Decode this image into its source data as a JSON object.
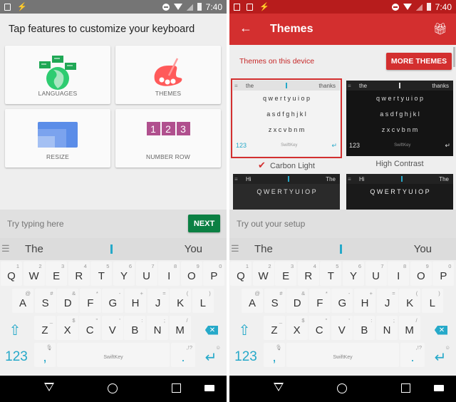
{
  "status_bar": {
    "time": "7:40"
  },
  "left_screen": {
    "title": "Tap features to customize your keyboard",
    "features": [
      {
        "label": "LANGUAGES",
        "icon": "globe-chat-icon"
      },
      {
        "label": "THEMES",
        "icon": "palette-icon"
      },
      {
        "label": "RESIZE",
        "icon": "resize-icon"
      },
      {
        "label": "NUMBER ROW",
        "icon": "number-row-icon",
        "digits": [
          "1",
          "2",
          "3"
        ]
      }
    ],
    "input_placeholder": "Try typing here",
    "next_label": "NEXT",
    "colors": {
      "next": "#0b8043",
      "languages": "#2ecc71",
      "themes": "#ff5a5a",
      "resize": "#5b8de8",
      "number_row": "#b0508e"
    }
  },
  "right_screen": {
    "title": "Themes",
    "section_label": "Themes on this device",
    "more_themes_label": "MORE THEMES",
    "themes": [
      {
        "name": "Carbon Light",
        "selected": true,
        "predictions": [
          "the",
          "thanks"
        ]
      },
      {
        "name": "High Contrast",
        "selected": false,
        "predictions": [
          "the",
          "thanks"
        ]
      },
      {
        "name": "",
        "selected": false,
        "predictions": [
          "Hi",
          "The"
        ]
      },
      {
        "name": "",
        "selected": false,
        "predictions": [
          "Hi",
          "The"
        ]
      }
    ],
    "input_placeholder": "Try out your setup",
    "colors": {
      "accent": "#d32f2f"
    }
  },
  "keyboard": {
    "predictions": [
      "The",
      "You"
    ],
    "row1": [
      {
        "k": "Q",
        "h": "1"
      },
      {
        "k": "W",
        "h": "2"
      },
      {
        "k": "E",
        "h": "3"
      },
      {
        "k": "R",
        "h": "4"
      },
      {
        "k": "T",
        "h": "5"
      },
      {
        "k": "Y",
        "h": "6"
      },
      {
        "k": "U",
        "h": "7"
      },
      {
        "k": "I",
        "h": "8"
      },
      {
        "k": "O",
        "h": "9"
      },
      {
        "k": "P",
        "h": "0"
      }
    ],
    "row2": [
      {
        "k": "A",
        "h": "@"
      },
      {
        "k": "S",
        "h": "#"
      },
      {
        "k": "D",
        "h": "&"
      },
      {
        "k": "F",
        "h": "*"
      },
      {
        "k": "G",
        "h": "-"
      },
      {
        "k": "H",
        "h": "+"
      },
      {
        "k": "J",
        "h": "="
      },
      {
        "k": "K",
        "h": "("
      },
      {
        "k": "L",
        "h": ")"
      }
    ],
    "row3": [
      {
        "k": "Z",
        "h": "_"
      },
      {
        "k": "X",
        "h": "$"
      },
      {
        "k": "C",
        "h": "\""
      },
      {
        "k": "V",
        "h": "'"
      },
      {
        "k": "B",
        "h": ":"
      },
      {
        "k": "N",
        "h": ";"
      },
      {
        "k": "M",
        "h": "/"
      }
    ],
    "numbers_label": "123",
    "comma": ",",
    "space_label": "SwiftKey",
    "period": ".",
    "period_hint": ",!?",
    "accent": "#26a9c9"
  },
  "mini_rows": {
    "lower": [
      "q w e r t y u i o p",
      "a s d f g h j k l",
      "z x c v b n m"
    ],
    "upper": [
      "Q W E R T Y U I O P"
    ]
  }
}
